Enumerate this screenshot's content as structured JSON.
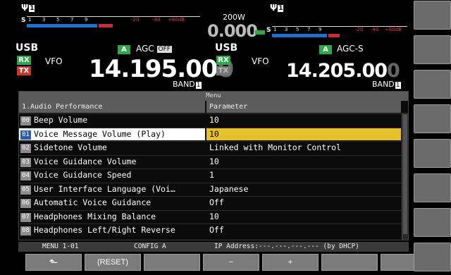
{
  "top": {
    "left": {
      "antenna_num": "1",
      "s_label": "S",
      "scale": [
        "1",
        "3",
        "5",
        "7",
        "9",
        "-20",
        "-40",
        "+60dB"
      ],
      "mode": "USB",
      "rx": "RX",
      "tx": "TX",
      "vfo": "VFO",
      "freq_main": "14.195.00",
      "freq_dim": "0",
      "a_badge": "A",
      "agc": "AGC",
      "agc_state": "OFF",
      "band": "BAND",
      "band_num": "1"
    },
    "center": {
      "power": "200W",
      "meter_freq": "0.000"
    },
    "right": {
      "antenna_num": "1",
      "s_label": "S",
      "scale": [
        "1",
        "3",
        "5",
        "7",
        "9",
        "-20",
        "-40",
        "+60dB"
      ],
      "mode": "USB",
      "rx": "RX",
      "tx": "TX",
      "vfo": "VFO",
      "freq_main": "14.205.00",
      "freq_dim": "0",
      "a_badge": "A",
      "agc": "AGC-S",
      "band": "BAND",
      "band_num": "1"
    }
  },
  "menu": {
    "title": "Menu",
    "group_header": "1.Audio Performance",
    "param_header": "Parameter",
    "rows": [
      {
        "num": "00",
        "name": "Beep Volume",
        "value": "10"
      },
      {
        "num": "01",
        "name": "Voice Message Volume (Play)",
        "value": "10"
      },
      {
        "num": "02",
        "name": "Sidetone Volume",
        "value": "Linked with Monitor Control"
      },
      {
        "num": "03",
        "name": "Voice Guidance Volume",
        "value": "10"
      },
      {
        "num": "04",
        "name": "Voice Guidance Speed",
        "value": "1"
      },
      {
        "num": "05",
        "name": "User Interface Language (Voi…",
        "value": "Japanese"
      },
      {
        "num": "06",
        "name": "Automatic Voice Guidance",
        "value": "Off"
      },
      {
        "num": "07",
        "name": "Headphones Mixing Balance",
        "value": "10"
      },
      {
        "num": "08",
        "name": "Headphones Left/Right Reverse",
        "value": "Off"
      }
    ]
  },
  "status": {
    "menu_id": "MENU 1-01",
    "config": "CONFIG A",
    "ip": "IP Address:---.---.---.--- (by DHCP)"
  },
  "fkeys": {
    "back": "⬑",
    "reset": "(RESET)",
    "minus": "−",
    "plus": "+"
  },
  "colors": {
    "selected_value": "#e7c12a",
    "selected_num": "#2a5db0",
    "rx_green": "#2fa84a",
    "tx_red": "#c8392b"
  }
}
